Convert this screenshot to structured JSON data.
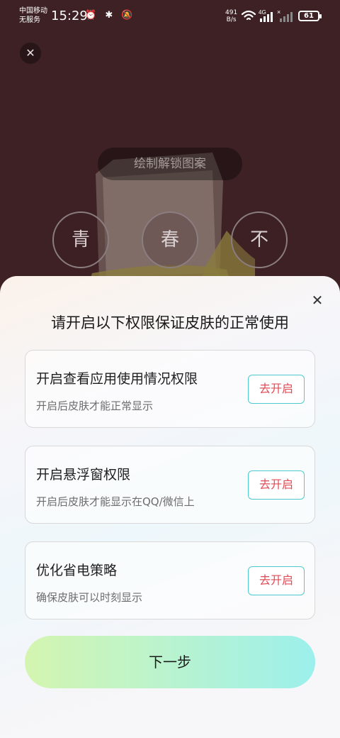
{
  "status_bar": {
    "carrier_line1": "中国移动",
    "carrier_line2": "无服务",
    "time": "15:29",
    "left_icons": "⏰ ✱ 🔕",
    "net_speed_value": "491",
    "net_speed_unit": "B/s",
    "network_type": "4G",
    "battery": "61"
  },
  "lock_screen": {
    "hint": "绘制解锁图案",
    "pattern_chars": [
      "青",
      "春",
      "不"
    ]
  },
  "sheet": {
    "title": "请开启以下权限保证皮肤的正常使用",
    "permissions": [
      {
        "title": "开启查看应用使用情况权限",
        "desc": "开启后皮肤才能正常显示",
        "button": "去开启"
      },
      {
        "title": "开启悬浮窗权限",
        "desc": "开启后皮肤才能显示在QQ/微信上",
        "button": "去开启"
      },
      {
        "title": "优化省电策略",
        "desc": "确保皮肤可以时刻显示",
        "button": "去开启"
      }
    ],
    "next_button": "下一步"
  },
  "colors": {
    "background": "#3d2124",
    "button_border": "#4fc9cf",
    "button_text": "#e14b56"
  }
}
